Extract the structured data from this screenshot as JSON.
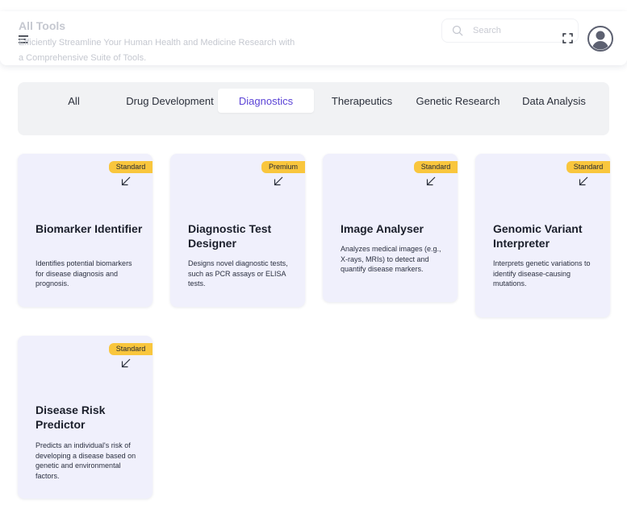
{
  "header": {
    "title": "All Tools",
    "subtitle": "Efficiently Streamline Your Human Health and Medicine Research with a Comprehensive Suite of Tools.",
    "search_placeholder": "Search"
  },
  "tabs": [
    {
      "label": "All",
      "active": false
    },
    {
      "label": "Drug Development",
      "active": false
    },
    {
      "label": "Diagnostics",
      "active": true
    },
    {
      "label": "Therapeutics",
      "active": false
    },
    {
      "label": "Genetic Research",
      "active": false
    },
    {
      "label": "Data Analysis",
      "active": false
    }
  ],
  "cards": [
    {
      "badge": "Standard",
      "title": "Biomarker Identifier",
      "description": "Identifies potential biomarkers for disease diagnosis and prognosis."
    },
    {
      "badge": "Premium",
      "title": "Diagnostic Test Designer",
      "description": "Designs novel diagnostic tests, such as PCR assays or ELISA tests."
    },
    {
      "badge": "Standard",
      "title": "Image Analyser",
      "description": "Analyzes medical images (e.g., X-rays, MRIs) to detect and quantify disease markers."
    },
    {
      "badge": "Standard",
      "title": "Genomic Variant Interpreter",
      "description": "Interprets genetic variations to identify disease-causing mutations."
    },
    {
      "badge": "Standard",
      "title": "Disease Risk Predictor",
      "description": "Predicts an individual's risk of developing a disease based on genetic and environmental factors."
    }
  ],
  "colors": {
    "accent": "#5b43d6",
    "badge": "#f9c63d",
    "card_bg": "#f0f0fc",
    "tabs_bg": "#f1f2f4"
  },
  "icons": {
    "menu": "hamburger-icon",
    "search": "search-icon",
    "fullscreen": "fullscreen-icon",
    "avatar": "user-avatar-icon",
    "card_action": "arrow-down-left-icon"
  }
}
